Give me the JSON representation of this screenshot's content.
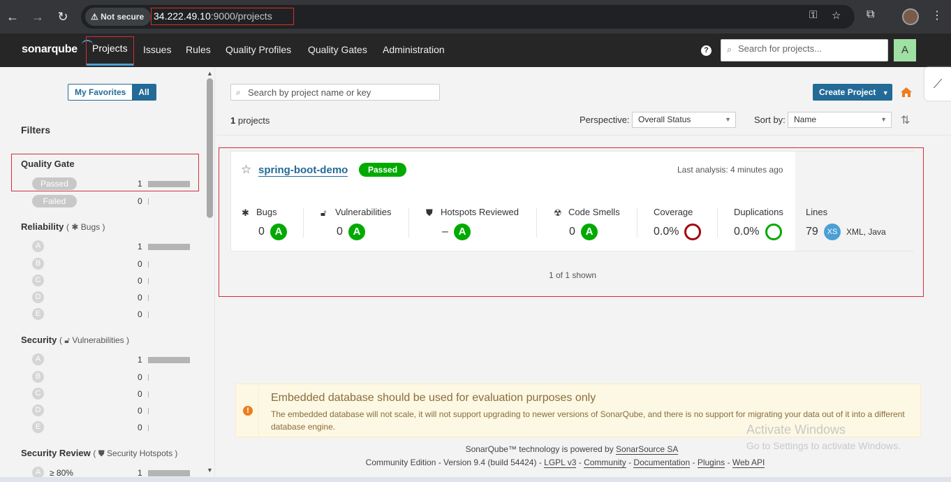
{
  "browser": {
    "security_label": "Not secure",
    "url_host": "34.222.49.10",
    "url_path": ":9000/projects"
  },
  "nav": {
    "logo": "sonarqube",
    "items": [
      "Projects",
      "Issues",
      "Rules",
      "Quality Profiles",
      "Quality Gates",
      "Administration"
    ],
    "search_placeholder": "Search for projects...",
    "avatar": "A"
  },
  "sidebar": {
    "my_favorites": "My Favorites",
    "all": "All",
    "filters_title": "Filters",
    "quality_gate": {
      "title": "Quality Gate",
      "options": [
        {
          "label": "Passed",
          "count": "1"
        },
        {
          "label": "Failed",
          "count": "0"
        }
      ]
    },
    "reliability": {
      "title": "Reliability",
      "sub": "Bugs",
      "ratings": [
        "A",
        "B",
        "C",
        "D",
        "E"
      ],
      "counts": [
        "1",
        "0",
        "0",
        "0",
        "0"
      ]
    },
    "security": {
      "title": "Security",
      "sub": "Vulnerabilities",
      "ratings": [
        "A",
        "B",
        "C",
        "D",
        "E"
      ],
      "counts": [
        "1",
        "0",
        "0",
        "0",
        "0"
      ]
    },
    "security_review": {
      "title": "Security Review",
      "sub": "Security Hotspots",
      "first": {
        "rating": "A",
        "label": "≥ 80%",
        "count": "1"
      }
    }
  },
  "main": {
    "search_placeholder": "Search by project name or key",
    "create_project": "Create Project",
    "project_count": "1",
    "projects_word": "projects",
    "perspective_label": "Perspective:",
    "perspective_value": "Overall Status",
    "sortby_label": "Sort by:",
    "sortby_value": "Name",
    "project": {
      "name": "spring-boot-demo",
      "status": "Passed",
      "last_analysis": "Last analysis: 4 minutes ago",
      "metrics": {
        "bugs": {
          "label": "Bugs",
          "value": "0",
          "grade": "A"
        },
        "vulnerabilities": {
          "label": "Vulnerabilities",
          "value": "0",
          "grade": "A"
        },
        "hotspots": {
          "label": "Hotspots Reviewed",
          "value": "–",
          "grade": "A"
        },
        "code_smells": {
          "label": "Code Smells",
          "value": "0",
          "grade": "A"
        },
        "coverage": {
          "label": "Coverage",
          "value": "0.0%"
        },
        "duplications": {
          "label": "Duplications",
          "value": "0.0%"
        },
        "lines": {
          "label": "Lines",
          "value": "79",
          "size": "XS",
          "languages": "XML, Java"
        }
      }
    },
    "shown": "1 of 1 shown"
  },
  "warning": {
    "title": "Embedded database should be used for evaluation purposes only",
    "text": "The embedded database will not scale, it will not support upgrading to newer versions of SonarQube, and there is no support for migrating your data out of it into a different database engine."
  },
  "footer": {
    "line1_prefix": "SonarQube™ technology is powered by",
    "line1_link": "SonarSource SA",
    "edition": "Community Edition - Version 9.4 (build 54424) -",
    "links": [
      "LGPL v3",
      "Community",
      "Documentation",
      "Plugins",
      "Web API"
    ]
  },
  "overlay": {
    "activate_title": "Activate Windows",
    "activate_sub": "Go to Settings to activate Windows."
  },
  "colors": {
    "brand_blue": "#236a97",
    "passed_green": "#00aa00",
    "coverage_red": "#a4030f",
    "highlight_red": "#d02f3a"
  }
}
